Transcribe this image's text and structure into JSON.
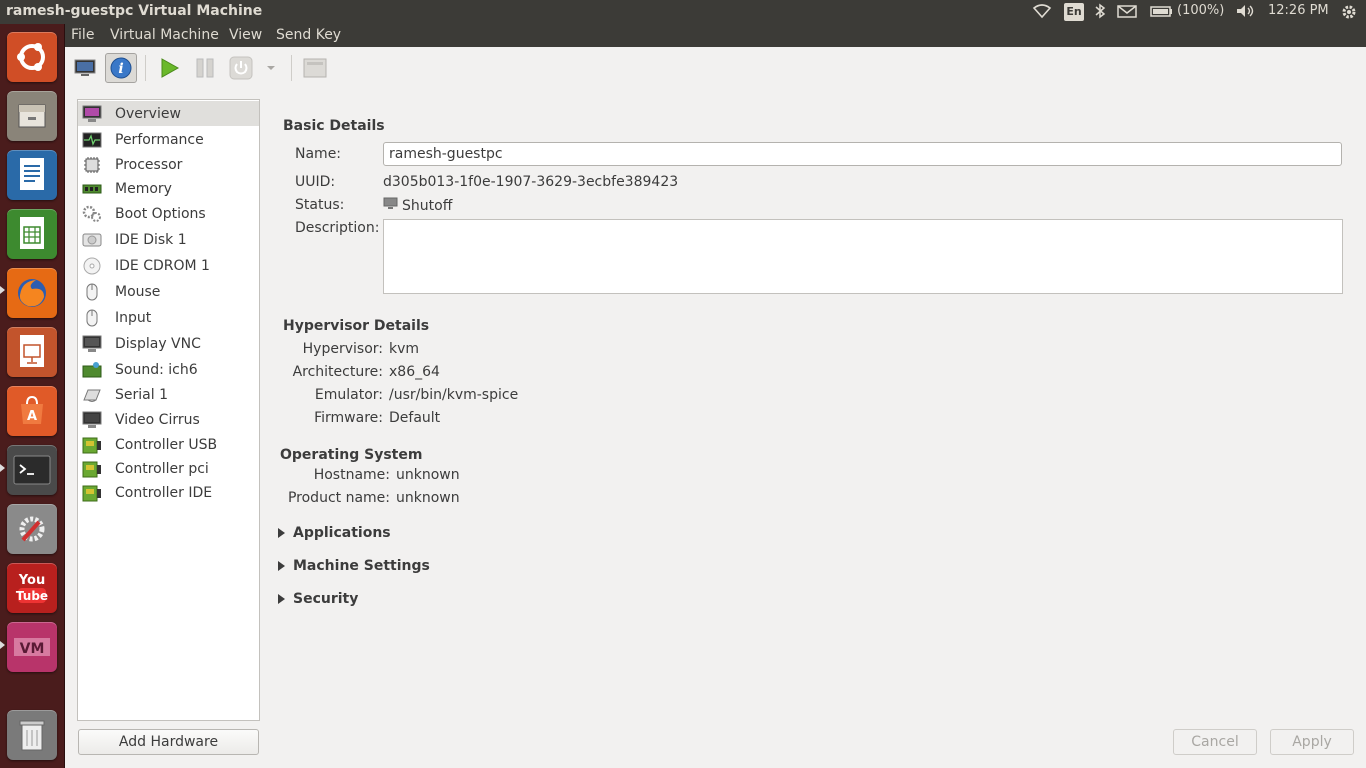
{
  "window": {
    "title": "ramesh-guestpc Virtual Machine"
  },
  "panel": {
    "language": "En",
    "battery": "(100%)",
    "time": "12:26 PM"
  },
  "launcher": [
    {
      "name": "ubuntu-dash-icon",
      "color": "#d04e26"
    },
    {
      "name": "files-icon",
      "color": "#8a8479"
    },
    {
      "name": "writer-icon",
      "color": "#2a6aa8"
    },
    {
      "name": "calc-icon",
      "color": "#3d8a2f"
    },
    {
      "name": "firefox-icon",
      "color": "#e66a14"
    },
    {
      "name": "impress-icon",
      "color": "#c2542c"
    },
    {
      "name": "software-center-icon",
      "color": "#e05a28"
    },
    {
      "name": "terminal-icon",
      "color": "#2b2b2b"
    },
    {
      "name": "system-settings-icon",
      "color": "#8a8a8a"
    },
    {
      "name": "youtube-icon",
      "color": "#b8201e"
    },
    {
      "name": "virt-manager-icon",
      "color": "#b8346a"
    },
    {
      "name": "trash-icon",
      "color": "#7a7a7a"
    }
  ],
  "menu": {
    "file": "File",
    "virtual_machine": "Virtual Machine",
    "view": "View",
    "send_key": "Send Key"
  },
  "toolbar": {
    "console_icon": "monitor-icon",
    "details_icon": "info-icon",
    "run_icon": "play-icon",
    "pause_icon": "pause-icon",
    "shutdown_icon": "power-icon",
    "fullscreen_icon": "fullscreen-icon"
  },
  "hardware": [
    {
      "label": "Overview",
      "icon": "overview-icon"
    },
    {
      "label": "Performance",
      "icon": "performance-icon"
    },
    {
      "label": "Processor",
      "icon": "processor-icon"
    },
    {
      "label": "Memory",
      "icon": "memory-icon"
    },
    {
      "label": "Boot Options",
      "icon": "boot-options-icon"
    },
    {
      "label": "IDE Disk 1",
      "icon": "disk-icon"
    },
    {
      "label": "IDE CDROM 1",
      "icon": "cdrom-icon"
    },
    {
      "label": "Mouse",
      "icon": "mouse-icon"
    },
    {
      "label": "Input",
      "icon": "input-icon"
    },
    {
      "label": "Display VNC",
      "icon": "display-icon"
    },
    {
      "label": "Sound: ich6",
      "icon": "sound-icon"
    },
    {
      "label": "Serial 1",
      "icon": "serial-icon"
    },
    {
      "label": "Video Cirrus",
      "icon": "video-icon"
    },
    {
      "label": "Controller USB",
      "icon": "controller-icon"
    },
    {
      "label": "Controller pci",
      "icon": "controller-icon"
    },
    {
      "label": "Controller IDE",
      "icon": "controller-icon"
    }
  ],
  "add_hardware": "Add Hardware",
  "basic": {
    "title": "Basic Details",
    "name_label": "Name:",
    "name_value": "ramesh-guestpc",
    "uuid_label": "UUID:",
    "uuid_value": "d305b013-1f0e-1907-3629-3ecbfe389423",
    "status_label": "Status:",
    "status_value": "Shutoff",
    "description_label": "Description:",
    "description_value": ""
  },
  "hypervisor": {
    "title": "Hypervisor Details",
    "hypervisor_label": "Hypervisor:",
    "hypervisor_value": "kvm",
    "architecture_label": "Architecture:",
    "architecture_value": "x86_64",
    "emulator_label": "Emulator:",
    "emulator_value": "/usr/bin/kvm-spice",
    "firmware_label": "Firmware:",
    "firmware_value": "Default"
  },
  "os": {
    "title": "Operating System",
    "hostname_label": "Hostname:",
    "hostname_value": "unknown",
    "product_label": "Product name:",
    "product_value": "unknown"
  },
  "expanders": {
    "applications": "Applications",
    "machine_settings": "Machine Settings",
    "security": "Security"
  },
  "buttons": {
    "cancel": "Cancel",
    "apply": "Apply"
  }
}
